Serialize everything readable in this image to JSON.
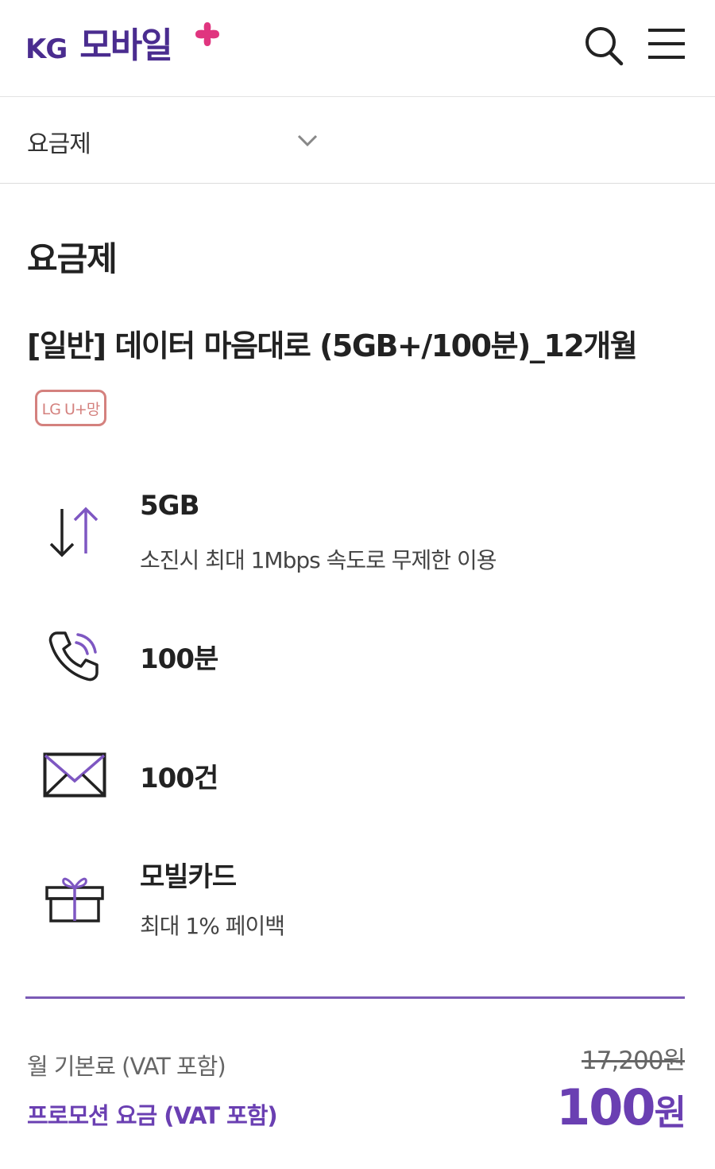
{
  "header": {
    "logo_kg": "KG",
    "logo_name": "모바일",
    "brand_purple": "#4a2c8f",
    "brand_pink": "#e0357f",
    "icons": [
      "search-icon",
      "hamburger-menu-icon"
    ]
  },
  "selector": {
    "label": "요금제",
    "icon": "chevron-down-icon"
  },
  "main": {
    "section_title": "요금제",
    "plan_name": "[일반] 데이터 마음대로 (5GB+/100분)_12개월",
    "network_badge": "LG U+망",
    "badge_color": "#d4817e",
    "features": [
      {
        "icon": "data-arrows-icon",
        "title": "5GB",
        "desc": "소진시 최대 1Mbps 속도로 무제한 이용"
      },
      {
        "icon": "phone-icon",
        "title": "100분",
        "desc": ""
      },
      {
        "icon": "envelope-icon",
        "title": "100건",
        "desc": ""
      },
      {
        "icon": "gift-icon",
        "title": "모빌카드",
        "desc": "최대 1% 페이백"
      }
    ]
  },
  "pricing": {
    "base_label": "월 기본료 (VAT 포함)",
    "base_price": "17,200원",
    "promo_label": "프로모션 요금 (VAT 포함)",
    "promo_amount": "100",
    "promo_unit": "원",
    "accent_color": "#6a3fb2"
  }
}
